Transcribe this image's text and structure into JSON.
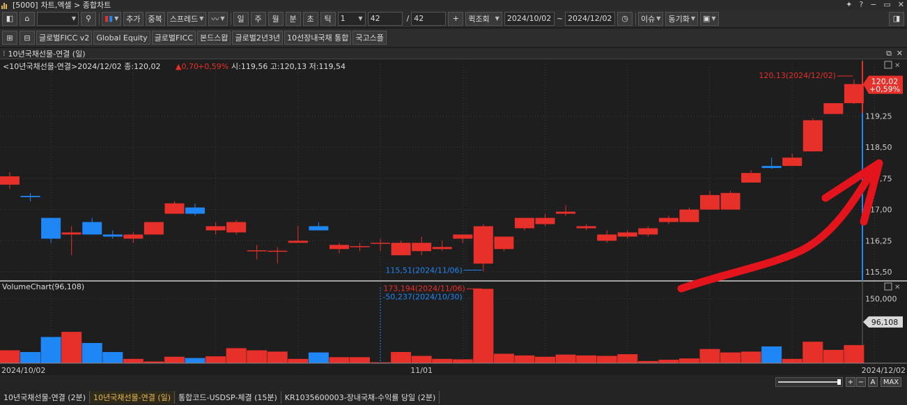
{
  "window": {
    "code": "[5000]",
    "title": "차트,엑셀 > 종합차트"
  },
  "toolbar": {
    "add": "추가",
    "overlap": "중복",
    "spread": "스프레드",
    "periods": [
      "일",
      "주",
      "월",
      "분",
      "초",
      "틱"
    ],
    "interval": "1",
    "count": "42",
    "count_total": "42",
    "quick_query": "퀵조회",
    "date_from": "2024/10/02",
    "date_to": "2024/12/02",
    "issue": "이슈",
    "sync": "동기화"
  },
  "favorites": [
    "글로벌FICC v2",
    "Global Equity",
    "글로벌FICC",
    "본드스왑",
    "글로벌2년3년",
    "10선장내국채 통합",
    "국고스플"
  ],
  "panel": {
    "title": "10년국채선물-연결 (일)"
  },
  "price_header": {
    "prefix": "<10년국채선물-연결>2024/12/02 종:120,02",
    "change": "▲0,70",
    "change_pct": "+0,59%",
    "rest": "시:119,56 고:120,13 저:119,54"
  },
  "volume_header": "VolumeChart(96,108)",
  "colors": {
    "up": "#e8302a",
    "down": "#1f86f5",
    "bg": "#1e1e1e",
    "arrow": "#e3141b",
    "grid": "#3a3a3a"
  },
  "chart_data": {
    "type": "candlestick",
    "ylim": [
      115.3,
      120.5
    ],
    "price_ticks": [
      {
        "label": "119,25",
        "v": 119.25
      },
      {
        "label": "118,50",
        "v": 118.5
      },
      {
        "label": "117,75",
        "v": 117.75
      },
      {
        "label": "117,00",
        "v": 117.0
      },
      {
        "label": "116,25",
        "v": 116.25
      },
      {
        "label": "115,50",
        "v": 115.5
      }
    ],
    "x_labels": [
      "2024/10/02",
      "11/01",
      "2024/12/02"
    ],
    "candles": [
      {
        "o": 117.6,
        "h": 117.9,
        "l": 117.5,
        "c": 117.8
      },
      {
        "o": 117.33,
        "h": 117.4,
        "l": 117.2,
        "c": 117.3
      },
      {
        "o": 116.8,
        "h": 116.8,
        "l": 116.2,
        "c": 116.3
      },
      {
        "o": 116.4,
        "h": 116.6,
        "l": 115.9,
        "c": 116.45
      },
      {
        "o": 116.7,
        "h": 116.8,
        "l": 116.4,
        "c": 116.4
      },
      {
        "o": 116.4,
        "h": 116.5,
        "l": 116.3,
        "c": 116.35
      },
      {
        "o": 116.3,
        "h": 116.45,
        "l": 116.2,
        "c": 116.4
      },
      {
        "o": 116.4,
        "h": 116.7,
        "l": 116.4,
        "c": 116.7
      },
      {
        "o": 116.9,
        "h": 117.2,
        "l": 116.9,
        "c": 117.15
      },
      {
        "o": 117.05,
        "h": 117.15,
        "l": 116.85,
        "c": 116.9
      },
      {
        "o": 116.5,
        "h": 116.7,
        "l": 116.4,
        "c": 116.6
      },
      {
        "o": 116.45,
        "h": 116.75,
        "l": 116.4,
        "c": 116.7
      },
      {
        "o": 116.0,
        "h": 116.15,
        "l": 115.8,
        "c": 116.02
      },
      {
        "o": 116.0,
        "h": 116.1,
        "l": 115.7,
        "c": 116.01
      },
      {
        "o": 116.2,
        "h": 116.6,
        "l": 116.2,
        "c": 116.25
      },
      {
        "o": 116.6,
        "h": 116.7,
        "l": 116.5,
        "c": 116.5
      },
      {
        "o": 116.05,
        "h": 116.2,
        "l": 115.95,
        "c": 116.15
      },
      {
        "o": 116.1,
        "h": 116.2,
        "l": 116.0,
        "c": 116.12
      },
      {
        "o": 116.2,
        "h": 116.3,
        "l": 116.0,
        "c": 116.2
      },
      {
        "o": 115.9,
        "h": 116.25,
        "l": 115.9,
        "c": 116.2
      },
      {
        "o": 116.0,
        "h": 116.35,
        "l": 115.9,
        "c": 116.2
      },
      {
        "o": 116.05,
        "h": 116.25,
        "l": 116.0,
        "c": 116.1
      },
      {
        "o": 116.3,
        "h": 116.4,
        "l": 116.2,
        "c": 116.4
      },
      {
        "o": 115.7,
        "h": 116.65,
        "l": 115.51,
        "c": 116.6
      },
      {
        "o": 116.05,
        "h": 116.35,
        "l": 116.0,
        "c": 116.35
      },
      {
        "o": 116.55,
        "h": 116.8,
        "l": 116.5,
        "c": 116.8
      },
      {
        "o": 116.65,
        "h": 116.9,
        "l": 116.6,
        "c": 116.8
      },
      {
        "o": 116.9,
        "h": 117.1,
        "l": 116.85,
        "c": 116.95
      },
      {
        "o": 116.55,
        "h": 116.65,
        "l": 116.5,
        "c": 116.6
      },
      {
        "o": 116.25,
        "h": 116.5,
        "l": 116.2,
        "c": 116.4
      },
      {
        "o": 116.35,
        "h": 116.5,
        "l": 116.3,
        "c": 116.45
      },
      {
        "o": 116.4,
        "h": 116.6,
        "l": 116.35,
        "c": 116.55
      },
      {
        "o": 116.7,
        "h": 116.85,
        "l": 116.65,
        "c": 116.8
      },
      {
        "o": 116.7,
        "h": 117.05,
        "l": 116.7,
        "c": 117.0
      },
      {
        "o": 117.0,
        "h": 117.45,
        "l": 117.0,
        "c": 117.35
      },
      {
        "o": 117.0,
        "h": 117.45,
        "l": 117.0,
        "c": 117.4
      },
      {
        "o": 117.65,
        "h": 117.95,
        "l": 117.65,
        "c": 117.88
      },
      {
        "o": 118.05,
        "h": 118.25,
        "l": 117.98,
        "c": 118.0
      },
      {
        "o": 118.05,
        "h": 118.35,
        "l": 118.05,
        "c": 118.25
      },
      {
        "o": 118.4,
        "h": 119.2,
        "l": 118.4,
        "c": 119.15
      },
      {
        "o": 119.3,
        "h": 119.5,
        "l": 119.3,
        "c": 119.56
      },
      {
        "o": 119.56,
        "h": 120.13,
        "l": 119.54,
        "c": 120.02
      }
    ],
    "volume": {
      "ylim": [
        0,
        190000
      ],
      "ticks": [
        {
          "label": "150,000",
          "v": 150000
        }
      ],
      "current_label": "96,108",
      "values": [
        30000,
        26000,
        61000,
        73000,
        47000,
        26000,
        10000,
        4000,
        15000,
        12000,
        16000,
        35000,
        30000,
        27000,
        10000,
        25000,
        14000,
        14000,
        2000,
        26000,
        17000,
        10000,
        9000,
        173194,
        22000,
        18000,
        15000,
        20000,
        18000,
        17000,
        21000,
        5000,
        8000,
        11000,
        33000,
        25000,
        27000,
        39000,
        10000,
        50000,
        31000,
        42000
      ]
    },
    "annotations": {
      "high_label": "120,13(2024/12/02)",
      "low_label": "115,51(2024/11/06)",
      "vol_high_label": "173,194(2024/11/06)",
      "vol_low_label": "-50,237(2024/10/30)",
      "price_box": "120,02",
      "price_box_pct": "+0,59%"
    }
  },
  "bottom_tabs": [
    "10년국채선물-연결 (2분)",
    "10년국채선물-연결 (일)",
    "통합코드-USDSP-체결 (15분)",
    "KR1035600003-장내국채-수익률 당일 (2분)"
  ],
  "scroll_buttons": [
    "+",
    "−",
    "A",
    "MAX"
  ]
}
